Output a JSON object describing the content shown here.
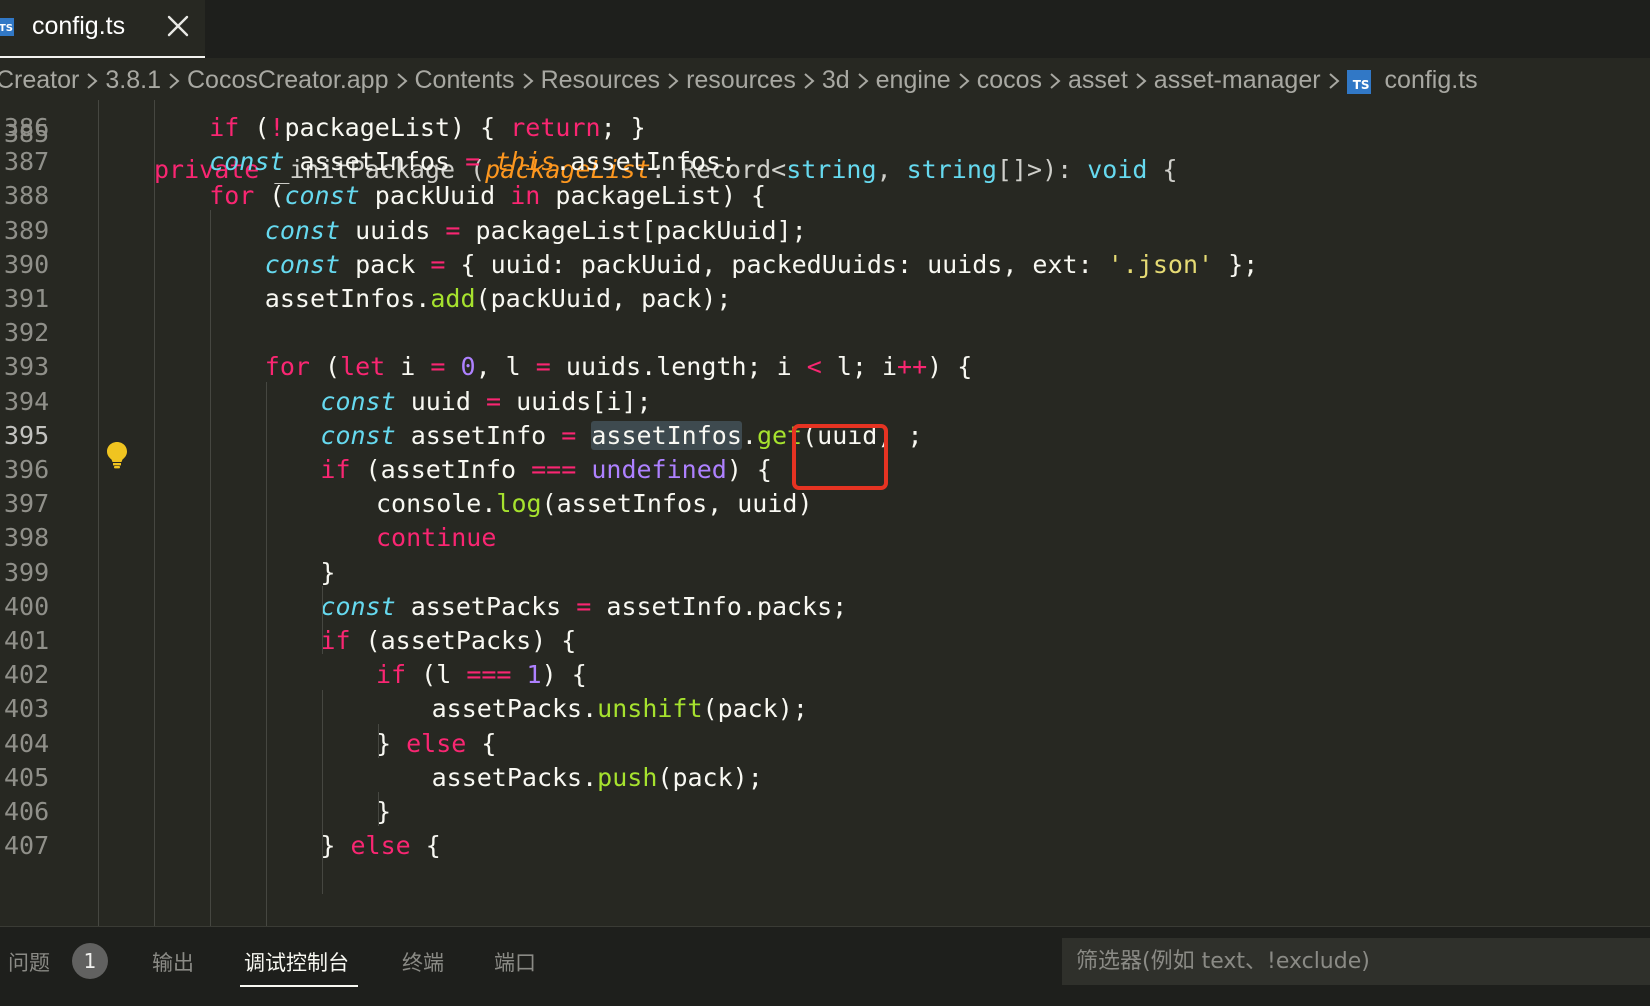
{
  "tab": {
    "title": "config.ts",
    "icon": "TS"
  },
  "breadcrumb": [
    "Creator",
    "3.8.1",
    "CocosCreator.app",
    "Contents",
    "Resources",
    "resources",
    "3d",
    "engine",
    "cocos",
    "asset",
    "asset-manager"
  ],
  "breadcrumb_file": "config.ts",
  "code_lines": [
    {
      "n": "386",
      "text": "if (!packageList) { return; }"
    },
    {
      "n": "387",
      "text": "const assetInfos = this.assetInfos;"
    },
    {
      "n": "388",
      "text": "for (const packUuid in packageList) {"
    },
    {
      "n": "389",
      "text": "const uuids = packageList[packUuid];"
    },
    {
      "n": "390",
      "text": "const pack = { uuid: packUuid, packedUuids: uuids, ext: '.json' };"
    },
    {
      "n": "391",
      "text": "assetInfos.add(packUuid, pack);"
    },
    {
      "n": "392",
      "text": ""
    },
    {
      "n": "393",
      "text": "for (let i = 0, l = uuids.length; i < l; i++) {"
    },
    {
      "n": "394",
      "text": "const uuid = uuids[i];"
    },
    {
      "n": "395",
      "text": "const assetInfo = assetInfos.get(uuid) ;"
    },
    {
      "n": "396",
      "text": "if (assetInfo === undefined) {"
    },
    {
      "n": "397",
      "text": "console.log(assetInfos, uuid)"
    },
    {
      "n": "398",
      "text": "continue"
    },
    {
      "n": "399",
      "text": "}"
    },
    {
      "n": "400",
      "text": "const assetPacks = assetInfo.packs;"
    },
    {
      "n": "401",
      "text": "if (assetPacks) {"
    },
    {
      "n": "402",
      "text": "if (l === 1) {"
    },
    {
      "n": "403",
      "text": "assetPacks.unshift(pack);"
    },
    {
      "n": "404",
      "text": "} else {"
    },
    {
      "n": "405",
      "text": "assetPacks.push(pack);"
    },
    {
      "n": "406",
      "text": "}"
    },
    {
      "n": "407",
      "text": "} else {"
    }
  ],
  "panel": {
    "tabs": [
      {
        "label": "问题",
        "badge": "1"
      },
      {
        "label": "输出"
      },
      {
        "label": "调试控制台",
        "active": true
      },
      {
        "label": "终端"
      },
      {
        "label": "端口"
      }
    ],
    "filter_placeholder": "筛选器(例如 text、!exclude)"
  },
  "colors": {
    "editor_bg": "#272822",
    "keyword": "#f92672",
    "storage": "#66d9ef",
    "function": "#a6e22e",
    "string": "#e6db74",
    "number": "#ae81ff",
    "highlight_box": "#e63322",
    "ts_icon": "#3178c6"
  }
}
